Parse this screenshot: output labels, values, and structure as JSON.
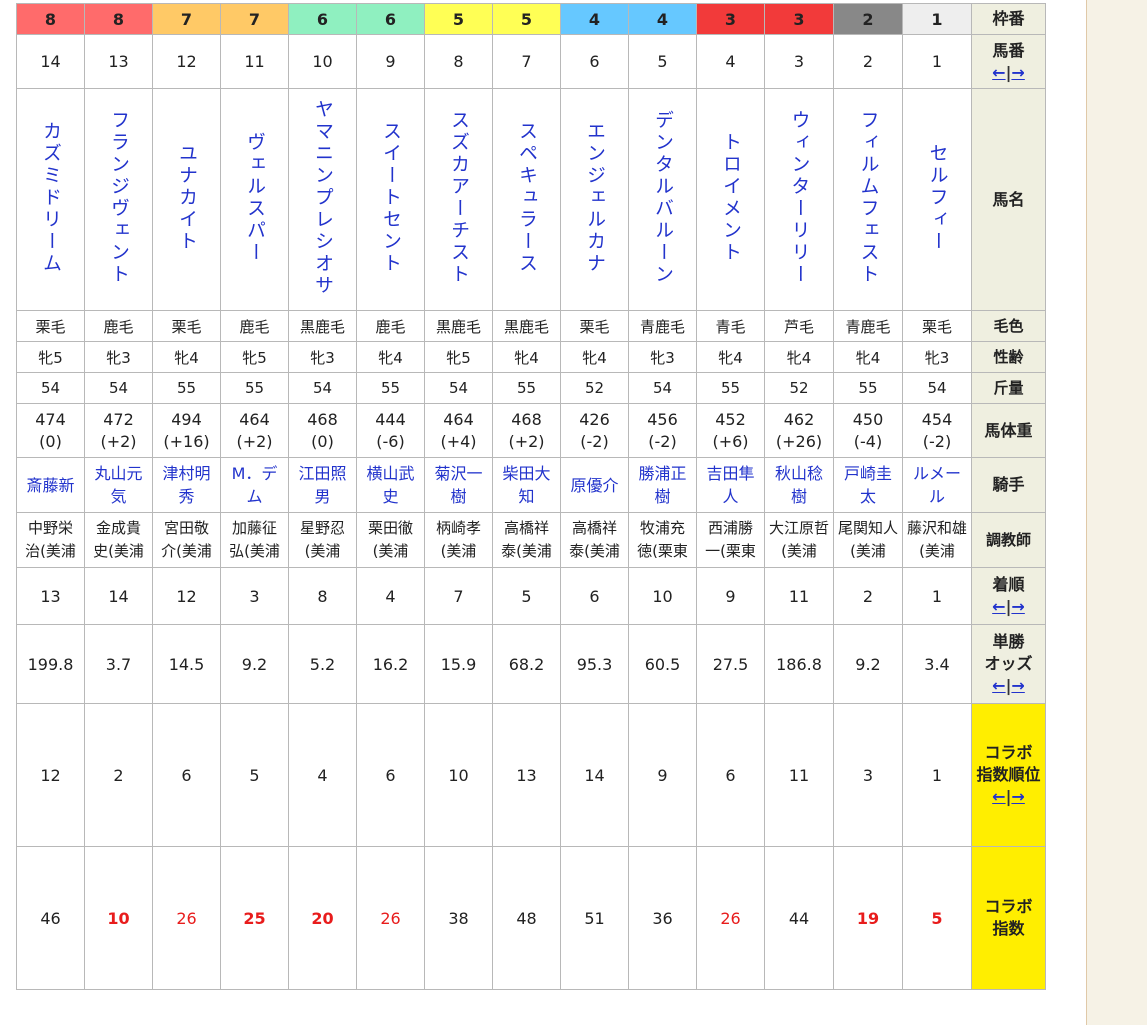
{
  "labels": {
    "frame": "枠番",
    "number": "馬番",
    "name": "馬名",
    "coat": "毛色",
    "sex_age": "性齢",
    "weight": "斤量",
    "body_weight": "馬体重",
    "jockey": "騎手",
    "trainer": "調教師",
    "finish": "着順",
    "odds_line1": "単勝",
    "odds_line2": "オッズ",
    "collab_rank_line1": "コラボ",
    "collab_rank_line2": "指数順位",
    "collab_index_line1": "コラボ",
    "collab_index_line2": "指数",
    "arrow_left": "←",
    "arrow_sep": "|",
    "arrow_right": "→"
  },
  "colors": {
    "frame_bg": {
      "8": "#ff6b6b",
      "7": "#ffc966",
      "6": "#8ff0c0",
      "5": "#ffff55",
      "4": "#66c8ff",
      "3": "#f23a3a",
      "2": "#888888",
      "1": "#eeeeee"
    },
    "frame_fg": {
      "8": "#222222",
      "7": "#222222",
      "6": "#222222",
      "5": "#222222",
      "4": "#222222",
      "3": "#222222",
      "2": "#222222",
      "1": "#222222"
    },
    "link": "#2233cc",
    "highlight_red": "#e81c1c",
    "header_bg": "#efefe0",
    "collab_header_bg": "#ffee00"
  },
  "horses": [
    {
      "frame": "8",
      "num": "14",
      "name": "カズミドリーム",
      "coat": "栗毛",
      "sex": "牝5",
      "wt": "54",
      "bw": "474",
      "bwd": "(0)",
      "jockey": "斎藤新",
      "trainer": "中野栄治(美浦",
      "finish": "13",
      "odds": "199.8",
      "crank": "12",
      "cidx": "46",
      "cidx_style": "normal"
    },
    {
      "frame": "8",
      "num": "13",
      "name": "フランジヴェント",
      "coat": "鹿毛",
      "sex": "牝3",
      "wt": "54",
      "bw": "472",
      "bwd": "(+2)",
      "jockey": "丸山元気",
      "trainer": "金成貴史(美浦",
      "finish": "14",
      "odds": "3.7",
      "crank": "2",
      "cidx": "10",
      "cidx_style": "bold-red"
    },
    {
      "frame": "7",
      "num": "12",
      "name": "ユナカイト",
      "coat": "栗毛",
      "sex": "牝4",
      "wt": "55",
      "bw": "494",
      "bwd": "(+16)",
      "jockey": "津村明秀",
      "trainer": "宮田敬介(美浦",
      "finish": "12",
      "odds": "14.5",
      "crank": "6",
      "cidx": "26",
      "cidx_style": "red"
    },
    {
      "frame": "7",
      "num": "11",
      "name": "ヴェルスパー",
      "coat": "鹿毛",
      "sex": "牝5",
      "wt": "55",
      "bw": "464",
      "bwd": "(+2)",
      "jockey": "M．デム",
      "trainer": "加藤征弘(美浦",
      "finish": "3",
      "odds": "9.2",
      "crank": "5",
      "cidx": "25",
      "cidx_style": "bold-red"
    },
    {
      "frame": "6",
      "num": "10",
      "name": "ヤマニンプレシオサ",
      "coat": "黒鹿毛",
      "sex": "牝3",
      "wt": "54",
      "bw": "468",
      "bwd": "(0)",
      "jockey": "江田照男",
      "trainer": "星野忍(美浦",
      "finish": "8",
      "odds": "5.2",
      "crank": "4",
      "cidx": "20",
      "cidx_style": "bold-red"
    },
    {
      "frame": "6",
      "num": "9",
      "name": "スイートセント",
      "coat": "鹿毛",
      "sex": "牝4",
      "wt": "55",
      "bw": "444",
      "bwd": "(-6)",
      "jockey": "横山武史",
      "trainer": "栗田徹(美浦",
      "finish": "4",
      "odds": "16.2",
      "crank": "6",
      "cidx": "26",
      "cidx_style": "red"
    },
    {
      "frame": "5",
      "num": "8",
      "name": "スズカアーチスト",
      "coat": "黒鹿毛",
      "sex": "牝5",
      "wt": "54",
      "bw": "464",
      "bwd": "(+4)",
      "jockey": "菊沢一樹",
      "trainer": "柄崎孝(美浦",
      "finish": "7",
      "odds": "15.9",
      "crank": "10",
      "cidx": "38",
      "cidx_style": "normal"
    },
    {
      "frame": "5",
      "num": "7",
      "name": "スペキュラース",
      "coat": "黒鹿毛",
      "sex": "牝4",
      "wt": "55",
      "bw": "468",
      "bwd": "(+2)",
      "jockey": "柴田大知",
      "trainer": "高橋祥泰(美浦",
      "finish": "5",
      "odds": "68.2",
      "crank": "13",
      "cidx": "48",
      "cidx_style": "normal"
    },
    {
      "frame": "4",
      "num": "6",
      "name": "エンジェルカナ",
      "coat": "栗毛",
      "sex": "牝4",
      "wt": "52",
      "bw": "426",
      "bwd": "(-2)",
      "jockey": "原優介",
      "trainer": "高橋祥泰(美浦",
      "finish": "6",
      "odds": "95.3",
      "crank": "14",
      "cidx": "51",
      "cidx_style": "normal"
    },
    {
      "frame": "4",
      "num": "5",
      "name": "デンタルバルーン",
      "coat": "青鹿毛",
      "sex": "牝3",
      "wt": "54",
      "bw": "456",
      "bwd": "(-2)",
      "jockey": "勝浦正樹",
      "trainer": "牧浦充徳(栗東",
      "finish": "10",
      "odds": "60.5",
      "crank": "9",
      "cidx": "36",
      "cidx_style": "normal"
    },
    {
      "frame": "3",
      "num": "4",
      "name": "トロイメント",
      "coat": "青毛",
      "sex": "牝4",
      "wt": "55",
      "bw": "452",
      "bwd": "(+6)",
      "jockey": "吉田隼人",
      "trainer": "西浦勝一(栗東",
      "finish": "9",
      "odds": "27.5",
      "crank": "6",
      "cidx": "26",
      "cidx_style": "red"
    },
    {
      "frame": "3",
      "num": "3",
      "name": "ウィンターリリー",
      "coat": "芦毛",
      "sex": "牝4",
      "wt": "52",
      "bw": "462",
      "bwd": "(+26)",
      "jockey": "秋山稔樹",
      "trainer": "大江原哲(美浦",
      "finish": "11",
      "odds": "186.8",
      "crank": "11",
      "cidx": "44",
      "cidx_style": "normal"
    },
    {
      "frame": "2",
      "num": "2",
      "name": "フィルムフェスト",
      "coat": "青鹿毛",
      "sex": "牝4",
      "wt": "55",
      "bw": "450",
      "bwd": "(-4)",
      "jockey": "戸崎圭太",
      "trainer": "尾関知人(美浦",
      "finish": "2",
      "odds": "9.2",
      "crank": "3",
      "cidx": "19",
      "cidx_style": "bold-red"
    },
    {
      "frame": "1",
      "num": "1",
      "name": "セルフィー",
      "coat": "栗毛",
      "sex": "牝3",
      "wt": "54",
      "bw": "454",
      "bwd": "(-2)",
      "jockey": "ルメール",
      "trainer": "藤沢和雄(美浦",
      "finish": "1",
      "odds": "3.4",
      "crank": "1",
      "cidx": "5",
      "cidx_style": "bold-red"
    }
  ]
}
